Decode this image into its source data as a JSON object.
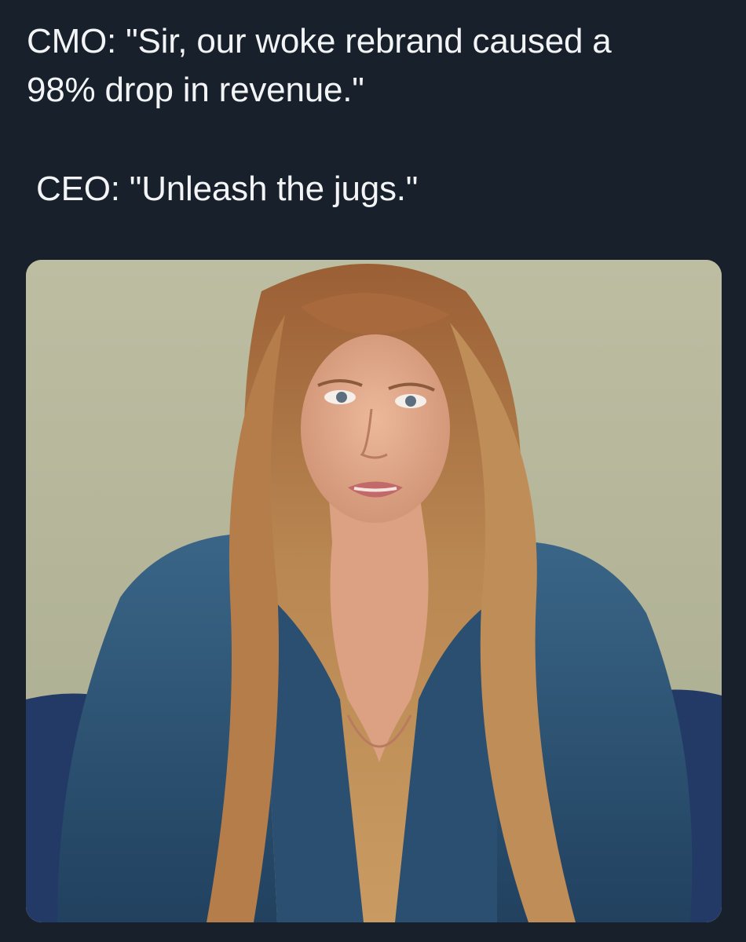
{
  "post": {
    "line1": "CMO: \"Sir, our woke rebrand caused a",
    "line2": "98% drop in revenue.\"",
    "line3": "CEO: \"Unleash the jugs.\""
  },
  "media": {
    "alt": "Photo of a woman with long wavy strawberry-blonde hair wearing an open denim jacket, leaning toward the camera against a pale olive wall and blue sofa"
  },
  "colors": {
    "background": "#17202b",
    "text": "#f2f4f6",
    "wall": "#b9b99d",
    "denim": "#2f5577",
    "sofa": "#243a66",
    "hair": "#b27d48",
    "skin": "#e2aa8a"
  }
}
